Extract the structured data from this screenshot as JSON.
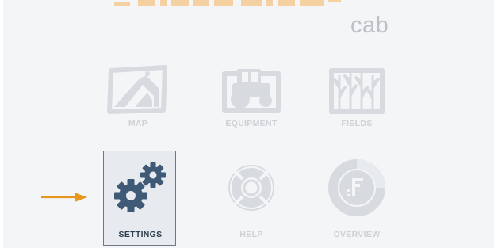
{
  "app": {
    "logo_word": "FIELDVIEW",
    "logo_sub": "cab"
  },
  "tiles": [
    {
      "id": "map",
      "label": "MAP",
      "icon": "map-icon",
      "selected": false
    },
    {
      "id": "equipment",
      "label": "EQUIPMENT",
      "icon": "tractor-icon",
      "selected": false
    },
    {
      "id": "fields",
      "label": "FIELDS",
      "icon": "crops-icon",
      "selected": false
    },
    {
      "id": "settings",
      "label": "SETTINGS",
      "icon": "gears-icon",
      "selected": true
    },
    {
      "id": "help",
      "label": "HELP",
      "icon": "lifebuoy-icon",
      "selected": false
    },
    {
      "id": "overview",
      "label": "OVERVIEW",
      "icon": "overview-icon",
      "selected": false
    }
  ],
  "colors": {
    "logo_orange": "#f6b25a",
    "icon_faded": "#d7dbe0",
    "icon_active": "#3f5a76",
    "arrow": "#e8961e",
    "label_faded": "#cdd2d7",
    "label_active": "#2d3e4f"
  }
}
